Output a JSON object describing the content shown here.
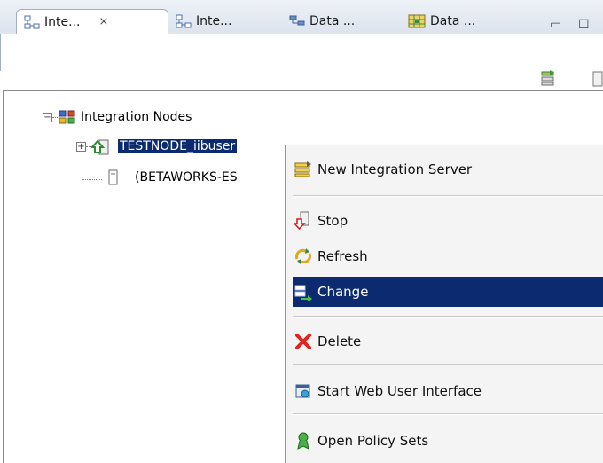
{
  "tabs": [
    {
      "label": "Inte...",
      "icon": "integration-nodes-icon",
      "active": true,
      "close": "⨯"
    },
    {
      "label": "Inte...",
      "icon": "integration-nodes-icon",
      "active": false
    },
    {
      "label": "Data ...",
      "icon": "data-design-icon",
      "active": false
    },
    {
      "label": "Data ...",
      "icon": "data-map-icon",
      "active": false
    }
  ],
  "view_controls": {
    "minimize": "▭",
    "maximize": "☐"
  },
  "tree": {
    "root_label": "Integration Nodes",
    "root_expander": "−",
    "node_label": "TESTNODE_iibuser",
    "node_expander": "+",
    "child_label": "(BETAWORKS-ES"
  },
  "context_menu": {
    "items": [
      {
        "label": "New Integration Server",
        "icon": "new-server-icon"
      },
      {
        "label": "Stop",
        "icon": "stop-icon"
      },
      {
        "label": "Refresh",
        "icon": "refresh-icon"
      },
      {
        "label": "Change",
        "icon": "change-icon",
        "highlighted": true
      },
      {
        "label": "Delete",
        "icon": "delete-icon"
      },
      {
        "label": "Start Web User Interface",
        "icon": "web-ui-icon"
      },
      {
        "label": "Open Policy Sets",
        "icon": "policy-sets-icon"
      }
    ]
  },
  "colors": {
    "selection": "#0c2a6f",
    "menu_bg": "#f4f4f4",
    "tab_bg": "#dde4ee"
  }
}
